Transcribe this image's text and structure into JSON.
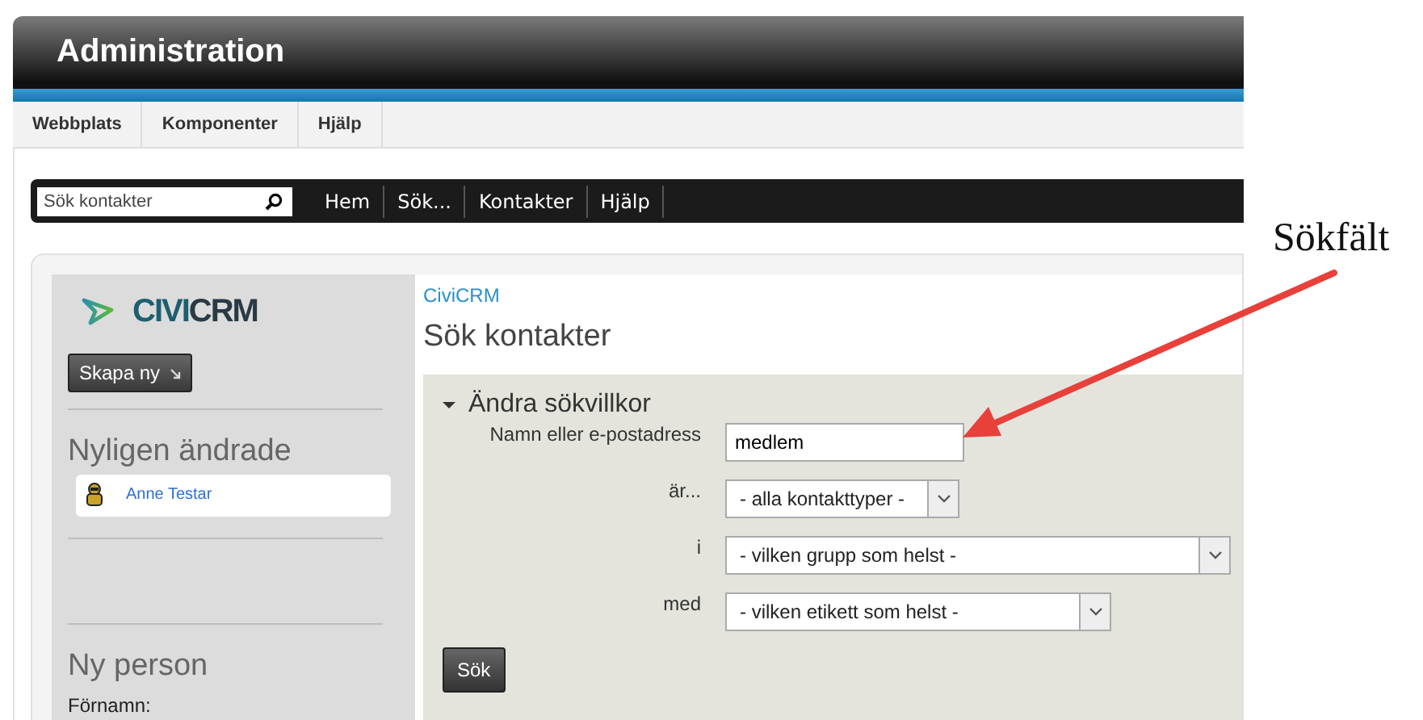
{
  "header": {
    "title": "Administration"
  },
  "menu": [
    {
      "label": "Webbplats"
    },
    {
      "label": "Komponenter"
    },
    {
      "label": "Hjälp"
    }
  ],
  "nav": {
    "search": {
      "placeholder": "Sök kontakter"
    },
    "links": [
      "Hem",
      "Sök...",
      "Kontakter",
      "Hjälp"
    ]
  },
  "sidebar": {
    "logo": {
      "prefix": "CIVI",
      "suffix": "CRM"
    },
    "create_button": "Skapa ny",
    "recent": {
      "title": "Nyligen ändrade",
      "items": [
        {
          "name": "Anne Testar"
        }
      ]
    },
    "new_person": {
      "title": "Ny person",
      "fields": [
        "Förnamn:"
      ]
    }
  },
  "main": {
    "breadcrumb": "CiviCRM",
    "title": "Sök kontakter",
    "criteria": {
      "title": "Ändra sökvillkor",
      "expanded": true,
      "fields": [
        {
          "kind": "text",
          "label": "Namn eller e-postadress",
          "value": "medlem"
        },
        {
          "kind": "select",
          "label": "är...",
          "value": "- alla kontakttyper -"
        },
        {
          "kind": "select",
          "label": "i",
          "value": "- vilken grupp som helst -"
        },
        {
          "kind": "select",
          "label": "med",
          "value": "- vilken etikett som helst -"
        }
      ],
      "submit": "Sök"
    }
  },
  "annotation": {
    "label": "Sökfält"
  }
}
